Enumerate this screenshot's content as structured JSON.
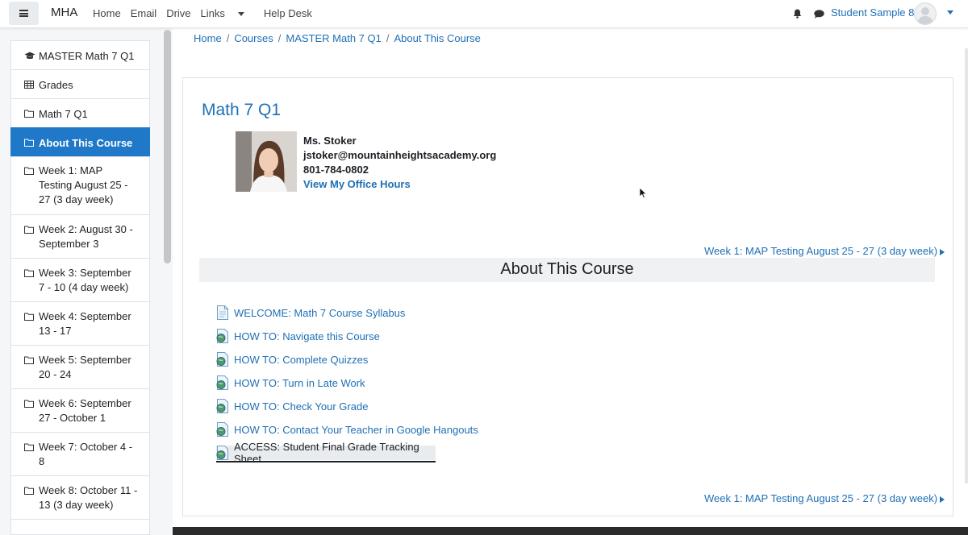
{
  "navbar": {
    "brand": "MHA",
    "links": [
      "Home",
      "Email",
      "Drive",
      "Links",
      "Help Desk"
    ],
    "user_name": "Student Sample 8"
  },
  "sidebar": {
    "items": [
      {
        "label": "MASTER Math 7 Q1",
        "icon": "graduation-cap-icon",
        "active": false
      },
      {
        "label": "Grades",
        "icon": "table-icon",
        "active": false
      },
      {
        "label": "Math 7 Q1",
        "icon": "folder-icon",
        "active": false
      },
      {
        "label": "About This Course",
        "icon": "folder-icon",
        "active": true
      },
      {
        "label": "Week 1: MAP Testing August 25 - 27 (3 day week)",
        "icon": "folder-icon",
        "active": false
      },
      {
        "label": "Week 2: August 30 - September 3",
        "icon": "folder-icon",
        "active": false
      },
      {
        "label": "Week 3: September 7 - 10 (4 day week)",
        "icon": "folder-icon",
        "active": false
      },
      {
        "label": "Week 4: September 13 - 17",
        "icon": "folder-icon",
        "active": false
      },
      {
        "label": "Week 5: September 20 - 24",
        "icon": "folder-icon",
        "active": false
      },
      {
        "label": "Week 6: September 27 - October 1",
        "icon": "folder-icon",
        "active": false
      },
      {
        "label": "Week 7: October 4 - 8",
        "icon": "folder-icon",
        "active": false
      },
      {
        "label": "Week 8: October 11 - 13 (3 day week)",
        "icon": "folder-icon",
        "active": false
      }
    ]
  },
  "breadcrumb": [
    "Home",
    "Courses",
    "MASTER Math 7 Q1",
    "About This Course"
  ],
  "course": {
    "title": "Math 7 Q1",
    "teacher": {
      "name": "Ms. Stoker",
      "email": "jstoker@mountainheightsacademy.org",
      "phone": "801-784-0802",
      "office_hours_link": "View My Office Hours"
    }
  },
  "section": {
    "next_link": "Week 1: MAP Testing August 25 - 27 (3 day week)",
    "title": "About This Course",
    "activities": [
      "WELCOME: Math 7 Course Syllabus",
      "HOW TO: Navigate this Course",
      "HOW TO: Complete Quizzes",
      "HOW TO: Turn in Late Work",
      "HOW TO: Check Your Grade",
      "HOW TO: Contact Your Teacher in Google Hangouts",
      "ACCESS: Student Final Grade Tracking Sheet"
    ]
  },
  "colors": {
    "link": "#1f6fb5",
    "active_nav": "#1f78c8"
  }
}
